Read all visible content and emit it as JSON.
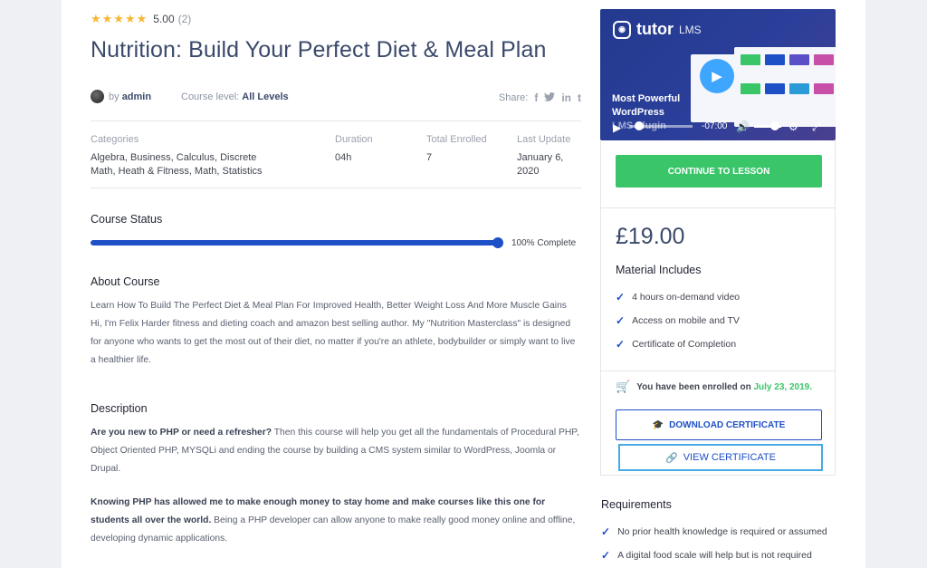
{
  "course": {
    "rating_score": "5.00",
    "rating_count": "(2)",
    "title": "Nutrition: Build Your Perfect Diet & Meal Plan",
    "by_prefix": "by",
    "author": "admin",
    "level_label": "Course level:",
    "level_value": "All Levels",
    "share_label": "Share:"
  },
  "info": {
    "categories_label": "Categories",
    "categories_value": "Algebra, Business, Calculus, Discrete Math, Heath & Fitness, Math, Statistics",
    "duration_label": "Duration",
    "duration_value": "04h",
    "enrolled_label": "Total Enrolled",
    "enrolled_value": "7",
    "updated_label": "Last Update",
    "updated_value": "January 6, 2020"
  },
  "status": {
    "title": "Course Status",
    "progress_percent": 100,
    "progress_text": "100% Complete"
  },
  "about": {
    "title": "About Course",
    "text": "Learn How To Build The Perfect Diet & Meal Plan For Improved Health, Better Weight Loss And More Muscle Gains Hi, I'm Felix Harder fitness and dieting coach and amazon best selling author. My \"Nutrition Masterclass\" is designed for anyone who wants to get the most out of their diet, no matter if you're an athlete, bodybuilder or simply want to live a healthier life."
  },
  "description": {
    "title": "Description",
    "p1_bold": "Are you new to PHP or need a refresher?",
    "p1_rest": " Then this course will help you get all the fundamentals of Procedural PHP, Object Oriented PHP, MYSQLi and ending the course by building a CMS system similar to WordPress, Joomla or Drupal.",
    "p2_bold": "Knowing PHP has allowed me to make enough money to stay home and make courses like this one for students all over the world.",
    "p2_rest": " Being a PHP developer can allow anyone to make really good money online and offline, developing dynamic applications."
  },
  "video": {
    "brand": "tutor",
    "brand_suffix": "LMS",
    "caption_line1": "Most Powerful",
    "caption_line2": "WordPress",
    "caption_line3": "LMS Plugin",
    "time": "-07:00",
    "accent": "#3ea6ff"
  },
  "sidebar": {
    "continue_label": "CONTINUE TO LESSON",
    "price": "£19.00",
    "material_title": "Material Includes",
    "materials": [
      "4 hours on-demand video",
      "Access on mobile and TV",
      "Certificate of Completion"
    ],
    "enrolled_prefix": "You have been enrolled on",
    "enrolled_date": "July 23, 2019.",
    "download_label": "DOWNLOAD CERTIFICATE",
    "view_label": "VIEW CERTIFICATE"
  },
  "requirements": {
    "title": "Requirements",
    "items": [
      "No prior health knowledge is required or assumed",
      "A digital food scale will help but is not required"
    ]
  },
  "colors": {
    "primary": "#1d4fc7",
    "success": "#3ac569",
    "star": "#f7b731",
    "title": "#3b4a6b"
  }
}
